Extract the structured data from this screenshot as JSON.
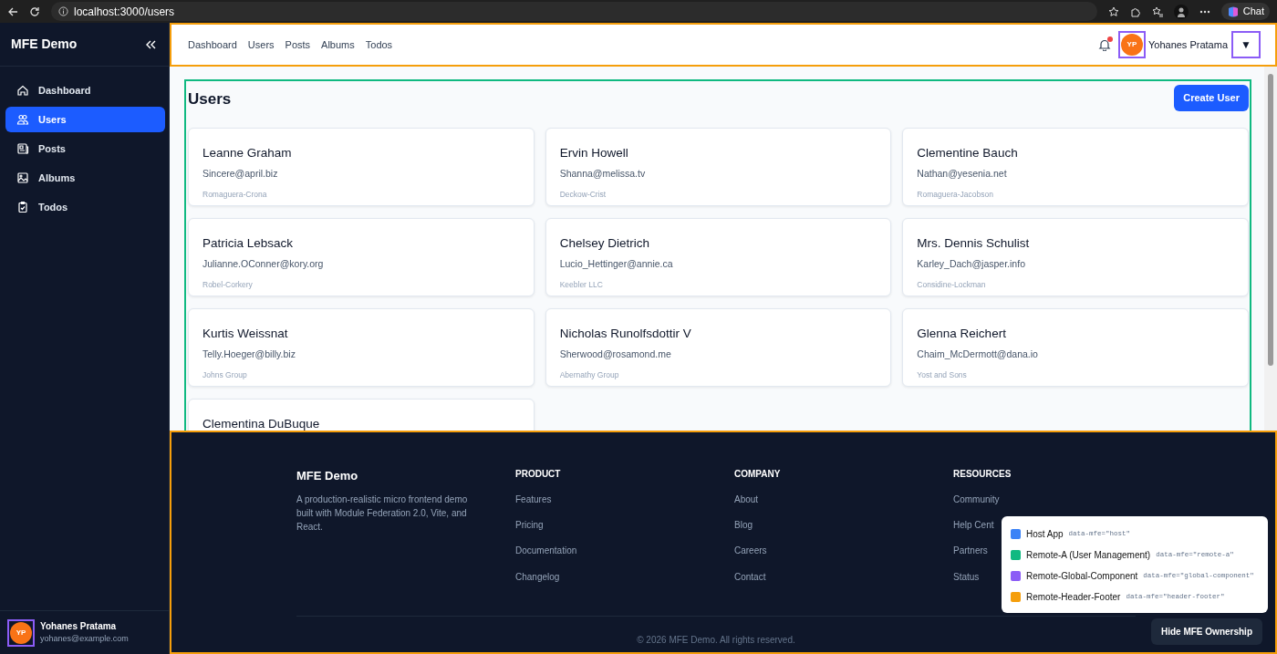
{
  "browser": {
    "url": "localhost:3000/users",
    "chat_label": "Chat"
  },
  "sidebar": {
    "title": "MFE Demo",
    "items": [
      {
        "label": "Dashboard",
        "selected": false
      },
      {
        "label": "Users",
        "selected": true
      },
      {
        "label": "Posts",
        "selected": false
      },
      {
        "label": "Albums",
        "selected": false
      },
      {
        "label": "Todos",
        "selected": false
      }
    ],
    "user": {
      "initials": "YP",
      "name": "Yohanes Pratama",
      "email": "yohanes@example.com"
    }
  },
  "header": {
    "links": [
      "Dashboard",
      "Users",
      "Posts",
      "Albums",
      "Todos"
    ],
    "notification_unread": true,
    "user": {
      "initials": "YP",
      "name": "Yohanes Pratama"
    },
    "menu_caret": "▼"
  },
  "page": {
    "title": "Users",
    "create_button": "Create User",
    "users": [
      {
        "name": "Leanne Graham",
        "email": "Sincere@april.biz",
        "company": "Romaguera-Crona"
      },
      {
        "name": "Ervin Howell",
        "email": "Shanna@melissa.tv",
        "company": "Deckow-Crist"
      },
      {
        "name": "Clementine Bauch",
        "email": "Nathan@yesenia.net",
        "company": "Romaguera-Jacobson"
      },
      {
        "name": "Patricia Lebsack",
        "email": "Julianne.OConner@kory.org",
        "company": "Robel-Corkery"
      },
      {
        "name": "Chelsey Dietrich",
        "email": "Lucio_Hettinger@annie.ca",
        "company": "Keebler LLC"
      },
      {
        "name": "Mrs. Dennis Schulist",
        "email": "Karley_Dach@jasper.info",
        "company": "Considine-Lockman"
      },
      {
        "name": "Kurtis Weissnat",
        "email": "Telly.Hoeger@billy.biz",
        "company": "Johns Group"
      },
      {
        "name": "Nicholas Runolfsdottir V",
        "email": "Sherwood@rosamond.me",
        "company": "Abernathy Group"
      },
      {
        "name": "Glenna Reichert",
        "email": "Chaim_McDermott@dana.io",
        "company": "Yost and Sons"
      },
      {
        "name": "Clementina DuBuque"
      }
    ]
  },
  "footer": {
    "brand": "MFE Demo",
    "description": "A production-realistic micro frontend demo built with Module Federation 2.0, Vite, and React.",
    "columns": [
      {
        "heading": "PRODUCT",
        "links": [
          "Features",
          "Pricing",
          "Documentation",
          "Changelog"
        ]
      },
      {
        "heading": "COMPANY",
        "links": [
          "About",
          "Blog",
          "Careers",
          "Contact"
        ]
      },
      {
        "heading": "RESOURCES",
        "links": [
          "Community",
          "Help Cent",
          "Partners",
          "Status"
        ]
      }
    ],
    "copyright": "© 2026 MFE Demo. All rights reserved."
  },
  "mfe_legend": {
    "items": [
      {
        "label": "Host App",
        "code": "data-mfe=\"host\"",
        "color": "#3b82f6"
      },
      {
        "label": "Remote-A (User Management)",
        "code": "data-mfe=\"remote-a\"",
        "color": "#10b981"
      },
      {
        "label": "Remote-Global-Component",
        "code": "data-mfe=\"global-component\"",
        "color": "#8b5cf6"
      },
      {
        "label": "Remote-Header-Footer",
        "code": "data-mfe=\"header-footer\"",
        "color": "#f59e0b"
      }
    ],
    "toggle_button": "Hide MFE Ownership"
  }
}
